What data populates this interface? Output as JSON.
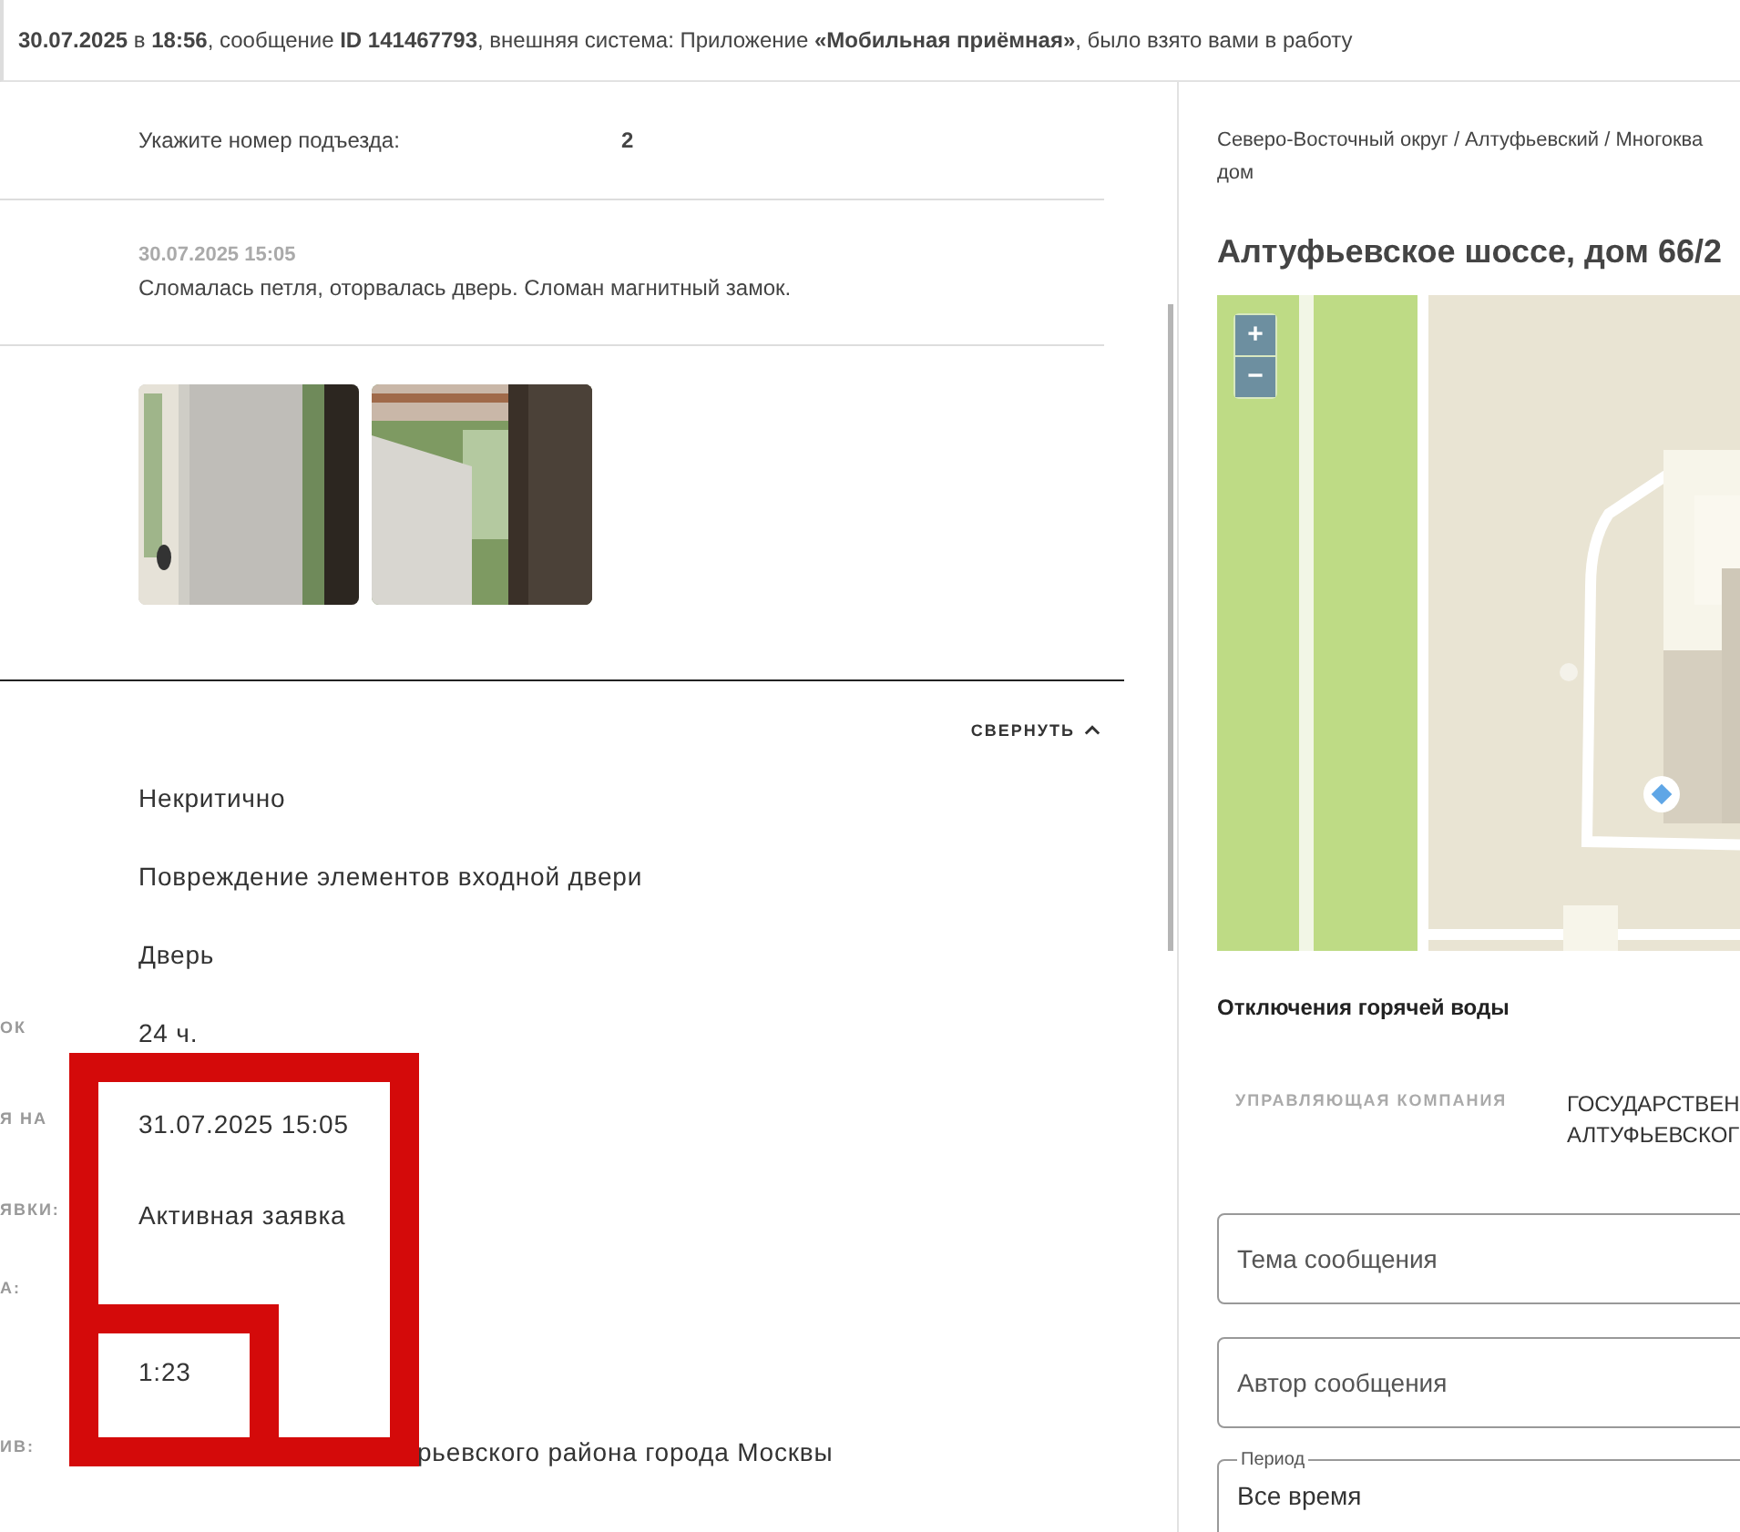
{
  "header": {
    "text": "**30.07.2025** в **18:56**, сообщение **ID 141467793**, внешняя система: Приложение **«Мобильная приёмная»**, было взято вами в работу"
  },
  "entrance": {
    "label": "Укажите номер подъезда:",
    "value": "2"
  },
  "comment": {
    "date": "30.07.2025 15:05",
    "text": "Сломалась петля, оторвалась дверь. Сломан магнитный замок."
  },
  "collapse_button": {
    "label": "СВЕРНУТЬ"
  },
  "details": [
    {
      "kind": "plain",
      "value": "Некритично"
    },
    {
      "kind": "plain",
      "value": "Повреждение элементов входной двери"
    },
    {
      "kind": "plain",
      "value": "Дверь"
    },
    {
      "kind": "plain",
      "label": "ОК",
      "value": "24 ч."
    },
    {
      "kind": "plain",
      "label": "Я НА",
      "value": "31.07.2025 15:05"
    },
    {
      "kind": "plain",
      "label": "ЯВКИ:",
      "value": "Активная заявка"
    },
    {
      "kind": "plain",
      "label": "А:"
    },
    {
      "kind": "plain",
      "value": "1:23"
    },
    {
      "kind": "covered",
      "label": "ИВ:",
      "value": "рьевского района города Москвы"
    }
  ],
  "address": {
    "breadcrumb": [
      "Северо-Восточный округ / Алтуфьевский / Многоква",
      "дом"
    ],
    "title": "Алтуфьевское шоссе, дом 66/2"
  },
  "map": {
    "zoom_in": "+",
    "zoom_out": "−"
  },
  "hot_water": {
    "title": "Отключения горячей воды"
  },
  "company": {
    "label": "УПРАВЛЯЮЩАЯ КОМПАНИЯ",
    "value": [
      "ГОСУДАРСТВЕН",
      "АЛТУФЬЕВСКОГ"
    ]
  },
  "fields": [
    {
      "placeholder": "Тема сообщения"
    },
    {
      "placeholder": "Автор сообщения"
    }
  ],
  "period": {
    "legend": "Период",
    "value": "Все время"
  }
}
